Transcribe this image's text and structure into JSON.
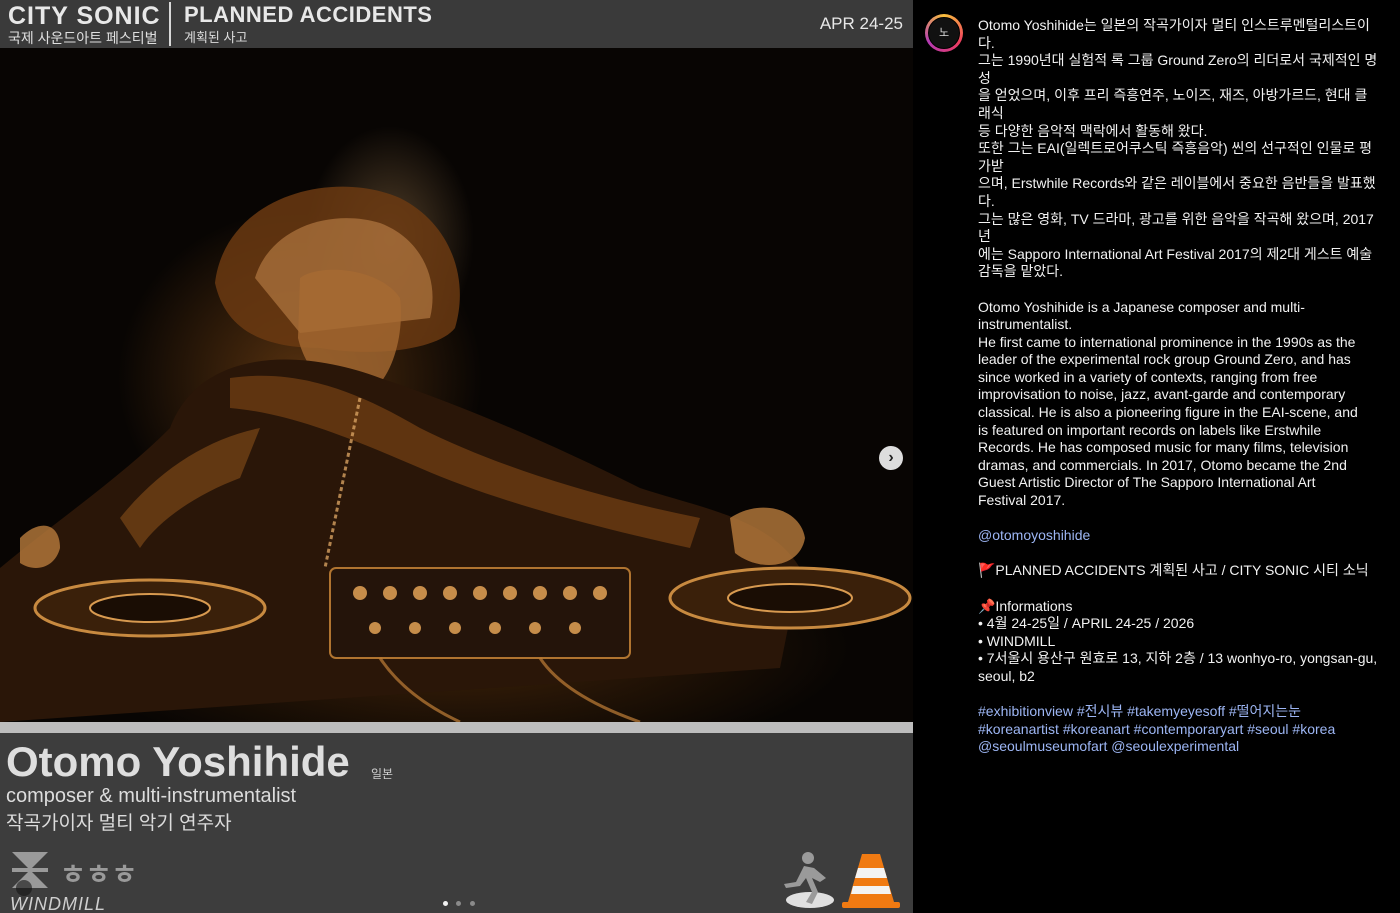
{
  "header": {
    "brand_title": "CITY SONIC",
    "brand_subtitle": "국제 사운드아트 페스티벌",
    "event_title": "PLANNED ACCIDENTS",
    "event_subtitle": "계획된 사고",
    "date": "APR 24-25"
  },
  "artist": {
    "name": "Otomo Yoshihide",
    "country": "일본",
    "role_en": "composer & multi-instrumentalist",
    "role_ko": "작곡가이자 멀티 악기 연주자"
  },
  "footer": {
    "venue_logo_text": "WINDMILL",
    "carousel": {
      "count": 3,
      "active_index": 0
    }
  },
  "post": {
    "avatar_label": "노",
    "caption_ko": [
      " Otomo Yoshihide는 일본의 작곡가이자 멀티 인스트루멘털리스트이다.",
      "그는 1990년대 실험적 록 그룹 Ground Zero의 리더로서 국제적인 명성",
      "을 얻었으며, 이후 프리 즉흥연주, 노이즈, 재즈, 아방가르드, 현대 클래식",
      "등 다양한 음악적 맥락에서 활동해 왔다.",
      "또한 그는 EAI(일렉트로어쿠스틱 즉흥음악) 씬의 선구적인 인물로 평가받",
      "으며, Erstwhile Records와 같은 레이블에서 중요한 음반들을 발표했다.",
      "그는 많은 영화, TV 드라마, 광고를 위한 음악을 작곡해 왔으며, 2017년",
      "에는 Sapporo International Art Festival 2017의 제2대 게스트 예술",
      "감독을 맡았다."
    ],
    "caption_en": [
      "Otomo Yoshihide is a Japanese composer and multi-",
      "instrumentalist.",
      "He first came to international prominence in the 1990s as the",
      "leader of the experimental rock group Ground Zero, and has",
      "since worked in a variety of contexts, ranging from free",
      "improvisation to noise, jazz, avant-garde and contemporary",
      "classical. He is also a pioneering figure in the EAI-scene, and",
      "is featured on important records on labels like Erstwhile",
      "Records. He has composed music for many films, television",
      "dramas, and commercials. In 2017, Otomo became the 2nd",
      "Guest Artistic Director of The Sapporo International Art",
      "Festival 2017."
    ],
    "mention": "@otomoyoshihide",
    "event_line": "🚩PLANNED ACCIDENTS 계획된 사고 / CITY SONIC 시티 소닉",
    "info_heading": "📌Informations",
    "info_lines": [
      "• 4월 24-25일 / APRIL 24-25 / 2026",
      "• WINDMILL",
      "• 7서울시 용산구 원효로 13, 지하 2층 / 13 wonhyo-ro, yongsan-gu,",
      "seoul, b2"
    ],
    "hashtag_lines": [
      [
        "#exhibitionview",
        "#전시뷰",
        "#takemyeyesoff",
        "#떨어지는눈"
      ],
      [
        "#koreanartist",
        "#koreanart",
        "#contemporaryart",
        "#seoul",
        "#korea"
      ],
      [
        "@seoulmuseumofart",
        "@seoulexperimental"
      ]
    ]
  },
  "colors": {
    "link": "#9db6f4",
    "header_bg": "#3a3a3a",
    "cone": "#f07a12"
  }
}
